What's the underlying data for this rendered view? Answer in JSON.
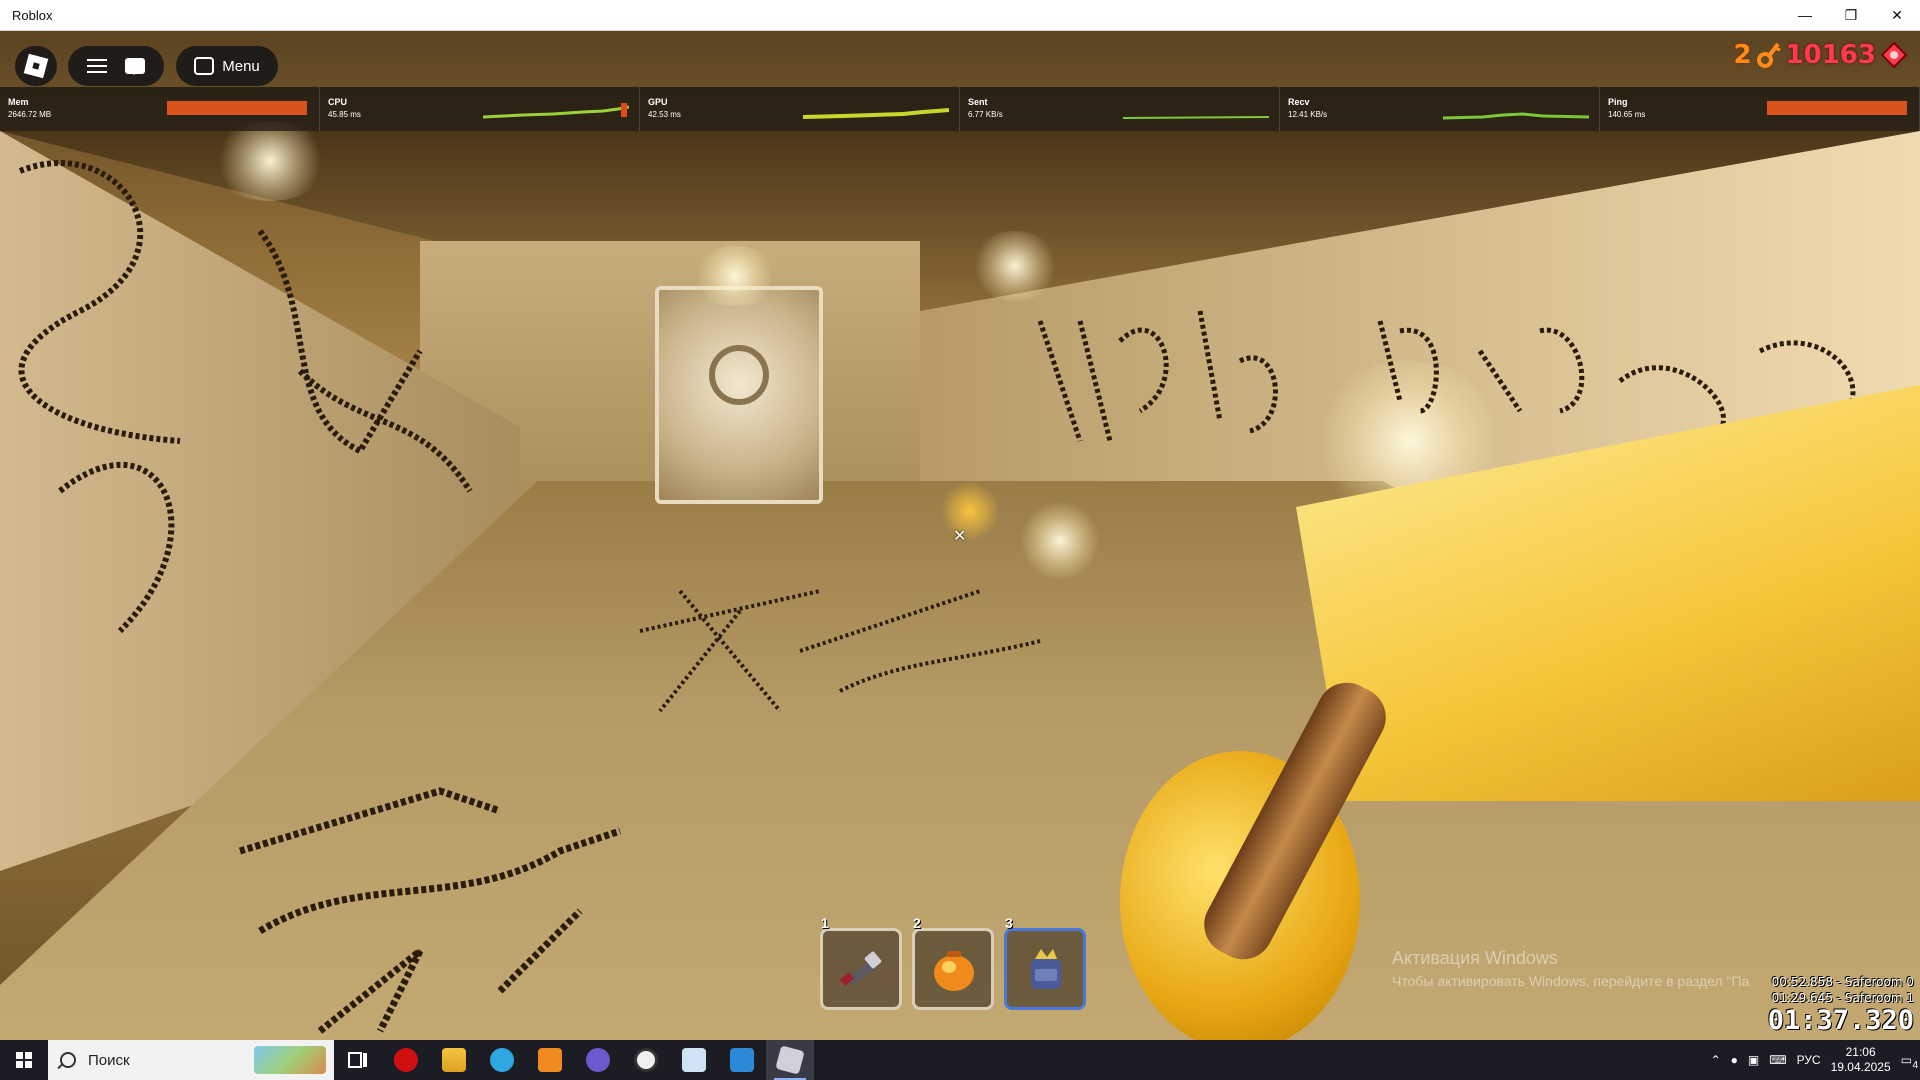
{
  "window": {
    "title": "Roblox",
    "controls": {
      "minimize": "—",
      "maximize": "❐",
      "close": "✕"
    }
  },
  "topbar": {
    "menu_label": "Menu"
  },
  "stats": [
    {
      "label": "Mem",
      "value": "2646.72 MB",
      "graph": "bar"
    },
    {
      "label": "CPU",
      "value": "45.85 ms",
      "graph": "line"
    },
    {
      "label": "GPU",
      "value": "42.53 ms",
      "graph": "line"
    },
    {
      "label": "Sent",
      "value": "6.77 KB/s",
      "graph": "line"
    },
    {
      "label": "Recv",
      "value": "12.41 KB/s",
      "graph": "line"
    },
    {
      "label": "Ping",
      "value": "140.65 ms",
      "graph": "bar"
    }
  ],
  "currency": {
    "keys": "2",
    "coins": "10163",
    "key_icon": "key-icon",
    "coin_icon": "gem-icon",
    "keys_color": "#ff8a1a",
    "coins_color": "#ff3a4a"
  },
  "hotbar": {
    "slots": [
      {
        "number": "1",
        "item": "flashlight-icon",
        "active": false
      },
      {
        "number": "2",
        "item": "lantern-icon",
        "active": false
      },
      {
        "number": "3",
        "item": "backpack-icon",
        "active": true
      }
    ]
  },
  "watermark": {
    "line1": "Активация Windows",
    "line2": "Чтобы активировать Windows, перейдите в раздел \"Па"
  },
  "timers": {
    "split1": "00:52.858 - Saferoom 0",
    "split2": "01:29.645 - Saferoom 1",
    "main": "01:37.320"
  },
  "taskbar": {
    "search_placeholder": "Поиск",
    "language": "РУС",
    "time": "21:06",
    "date": "19.04.2025",
    "notifications": "4",
    "apps": [
      "task-view-icon",
      "opera-icon",
      "file-explorer-icon",
      "telegram-icon",
      "sublime-text-icon",
      "discord-icon",
      "obs-icon",
      "notepad-icon",
      "vscode-icon",
      "roblox-icon"
    ]
  }
}
